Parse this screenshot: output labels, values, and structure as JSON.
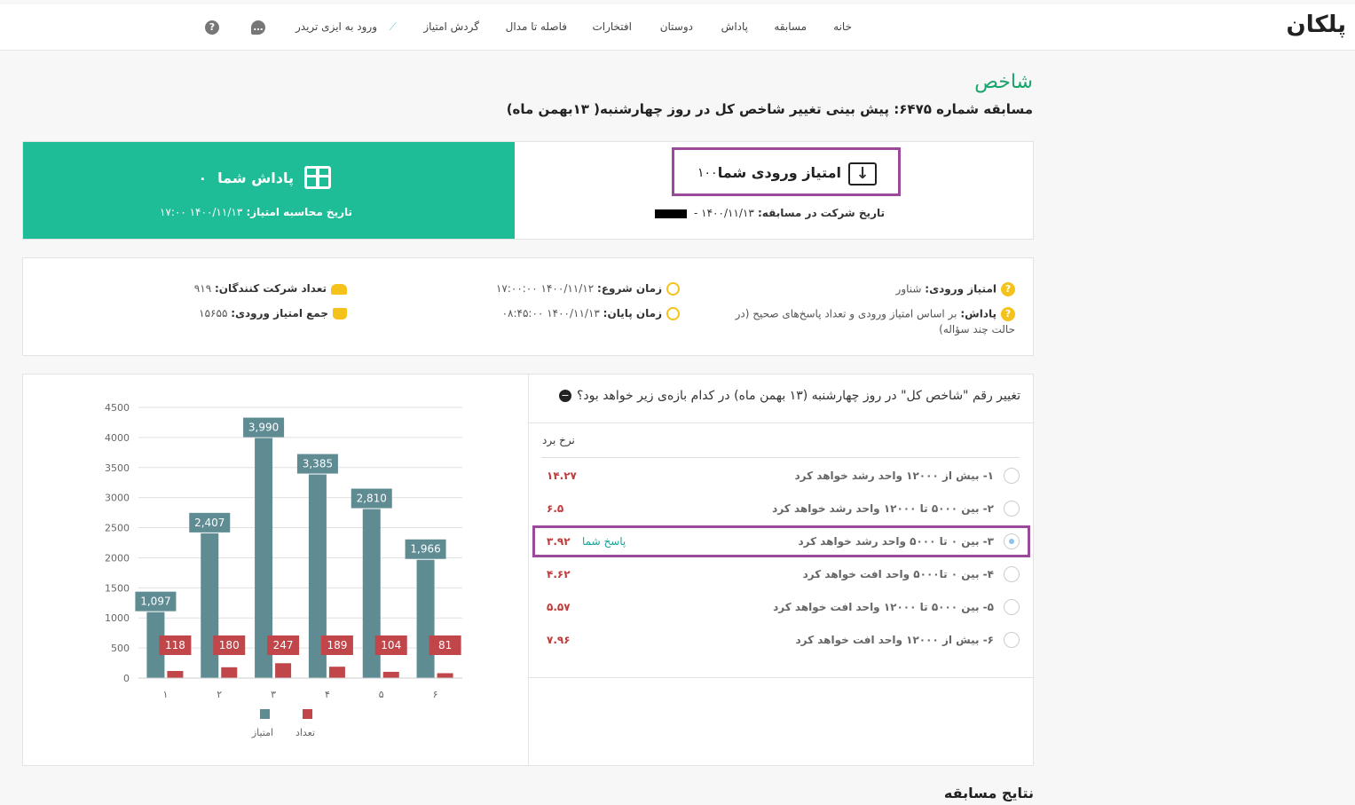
{
  "brand": "پلکان",
  "nav": {
    "items": [
      "خانه",
      "مسابقه",
      "پاداش",
      "دوستان",
      "افتخارات",
      "فاصله تا مدال",
      "گردش امتیاز",
      "ورود به ایزی تریدر"
    ],
    "chat_icon": "chat-icon",
    "help_icon": "help-icon"
  },
  "page": {
    "title": "شاخص",
    "subtitle": "مسابقه شماره ۶۴۷۵: پیش بینی تغییر شاخص کل در روز چهارشنبه( ۱۳بهمن ماه)"
  },
  "summary": {
    "entry_label": "امتیاز ورودی شما",
    "entry_value": "۱۰۰",
    "entry_date_label": "تاریخ شرکت در مسابقه:",
    "entry_date_value": "۱۴۰۰/۱۱/۱۳ -",
    "reward_label": "پاداش شما",
    "reward_value": "۰",
    "reward_date_label": "تاریخ محاسبه امتیاز:",
    "reward_date_value": "۱۴۰۰/۱۱/۱۳ ۱۷:۰۰"
  },
  "info": {
    "entry_type_label": "امتیاز ورودی:",
    "entry_type_value": "شناور",
    "reward_rule_label": "پاداش:",
    "reward_rule_value": "بر اساس امتیاز ورودی و تعداد پاسخ‌های صحیح (در",
    "reward_rule_value2": "حالت چند سؤاله)",
    "start_label": "زمان شروع:",
    "start_value": "۱۴۰۰/۱۱/۱۲ ۱۷:۰۰:۰۰",
    "end_label": "زمان پایان:",
    "end_value": "۱۴۰۰/۱۱/۱۳ ۰۸:۴۵:۰۰",
    "participants_label": "تعداد شرکت کنندگان:",
    "participants_value": "۹۱۹",
    "total_label": "جمع امتیاز ورودی:",
    "total_value": "۱۵۶۵۵"
  },
  "question": {
    "text": "تغییر رقم \"شاخص کل\" در روز چهارشنبه (۱۳ بهمن ماه) در کدام بازه‌ی زیر خواهد بود؟",
    "rate_header": "نرخ برد",
    "your_answer": "پاسخ شما",
    "options": [
      {
        "label": "۱-  بیش از ۱۲۰۰۰ واحد رشد خواهد کرد",
        "rate": "۱۴.۲۷",
        "selected": false
      },
      {
        "label": "۲-  بین ۵۰۰۰ تا ۱۲۰۰۰ واحد رشد خواهد کرد",
        "rate": "۶.۵",
        "selected": false
      },
      {
        "label": "۳-  بین ۰ تا ۵۰۰۰ واحد رشد خواهد کرد",
        "rate": "۳.۹۲",
        "selected": true
      },
      {
        "label": "۴-  بین ۰ تا۵۰۰۰ واحد افت خواهد کرد",
        "rate": "۴.۶۲",
        "selected": false
      },
      {
        "label": "۵-  بین ۵۰۰۰ تا ۱۲۰۰۰ واحد افت خواهد کرد",
        "rate": "۵.۵۷",
        "selected": false
      },
      {
        "label": "۶-  بیش از ۱۲۰۰۰ واحد افت خواهد کرد",
        "rate": "۷.۹۶",
        "selected": false
      }
    ]
  },
  "results_title": "نتایج مسابقه",
  "chart_data": {
    "type": "bar",
    "categories": [
      "۱",
      "۲",
      "۳",
      "۴",
      "۵",
      "۶"
    ],
    "series": [
      {
        "name": "امتیاز",
        "values": [
          1097,
          2407,
          3990,
          3385,
          2810,
          1966
        ],
        "labels": [
          "1,097",
          "2,407",
          "3,990",
          "3,385",
          "2,810",
          "1,966"
        ],
        "color": "#5f8b93"
      },
      {
        "name": "تعداد",
        "values": [
          118,
          180,
          247,
          189,
          104,
          81
        ],
        "labels": [
          "118",
          "180",
          "247",
          "189",
          "104",
          "81"
        ],
        "color": "#c0464a"
      }
    ],
    "yticks": [
      "0",
      "500",
      "1000",
      "1500",
      "2000",
      "2500",
      "3000",
      "3500",
      "4000",
      "4500"
    ],
    "ylim": [
      0,
      4500
    ],
    "grid": true,
    "legend": "bottom"
  },
  "colors": {
    "accent": "#1fbc98",
    "highlight": "#9b4a9a",
    "rate": "#c23b3b"
  }
}
